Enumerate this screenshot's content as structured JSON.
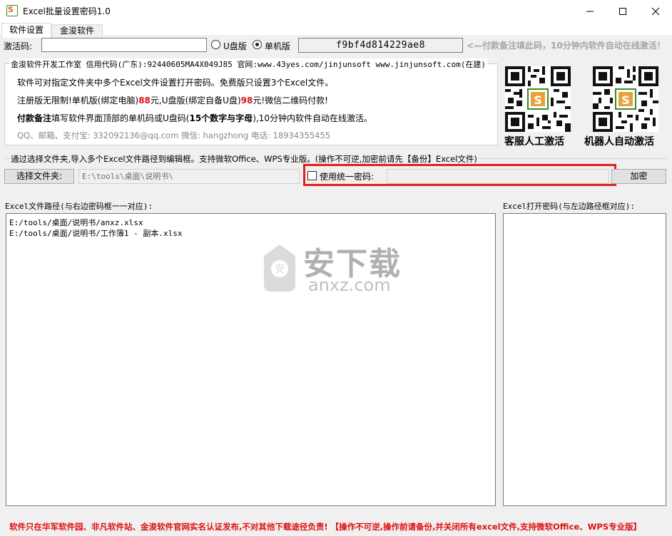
{
  "window": {
    "title": "Excel批量设置密码1.0",
    "app_icon_letter": "S"
  },
  "tabs": [
    {
      "label": "软件设置",
      "active": true
    },
    {
      "label": "金浚软件",
      "active": false
    }
  ],
  "activation": {
    "label": "激活码:",
    "input_value": "",
    "radio_u_label": "U盘版",
    "radio_pc_label": "单机版",
    "selected": "单机版",
    "machine_code": "f9bf4d814229ae8",
    "hint": "<—付款备注填此码，10分钟内软件自动在线激活！"
  },
  "info": {
    "title": "金浚软件开发工作室 信用代码(广东):92440605MA4X049J85 官网:www.43yes.com/jinjunsoft  www.jinjunsoft.com(在建)",
    "line1": "软件可对指定文件夹中多个Excel文件设置打开密码。免费版只设置3个Excel文件。",
    "line2_a": "注册版无限制!单机版(绑定电脑)",
    "line2_price1": "88",
    "line2_b": "元,U盘版(绑定自备U盘)",
    "line2_price2": "98",
    "line2_c": "元!微信二维码付款!",
    "line3_bold": "付款备注",
    "line3_a": "填写软件界面顶部的单机码或U盘码(",
    "line3_bold2": "15个数字与字母",
    "line3_b": "),10分钟内软件自动在线激活。",
    "line4": "QQ、邮箱、支付宝: 332092136@qq.com   微信: hangzhong   电话: 18934355455"
  },
  "qr": {
    "service_caption": "客服人工激活",
    "robot_caption": "机器人自动激活"
  },
  "folder": {
    "group_title": "通过选择文件夹,导入多个Excel文件路径到编辑框。支持微软Office、WPS专业版。(操作不可逆,加密前请先【备份】Excel文件)",
    "choose_button": "选择文件夹:",
    "path": "E:\\tools\\桌面\\说明书\\",
    "unified_checkbox_label": "使用统一密码:",
    "unified_checked": false,
    "unified_password": "",
    "encrypt_button": "加密"
  },
  "paths": {
    "label": "Excel文件路径(与右边密码框一一对应):",
    "items": [
      "E:/tools/桌面/说明书/anxz.xlsx",
      "E:/tools/桌面/说明书/工作簿1 - 副本.xlsx"
    ]
  },
  "passwords": {
    "label": "Excel打开密码(与左边路径框对应):",
    "items": []
  },
  "watermark": {
    "cn": "安下载",
    "en": "anxz.com"
  },
  "footer": "软件只在华军软件园、非凡软件站、金浚软件官网实名认证发布,不对其他下载途径负责! 【操作不可逆,操作前请备份,并关闭所有excel文件,支持微软Office、WPS专业版】",
  "colors": {
    "accent_red": "#e01010",
    "highlight_red": "#e02020",
    "panel_bg": "#f0f0f0"
  }
}
